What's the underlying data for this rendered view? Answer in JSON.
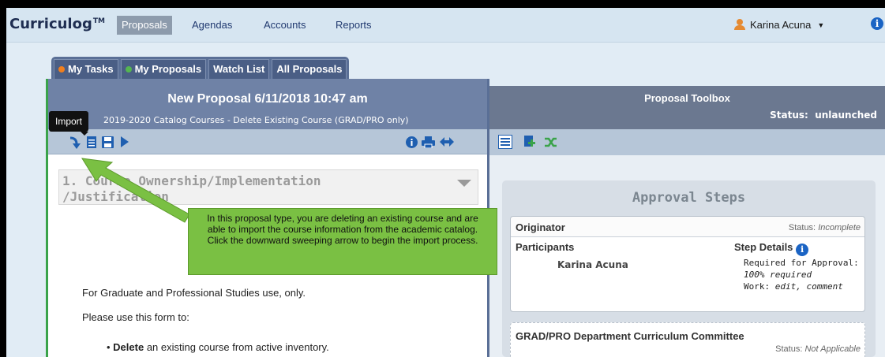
{
  "app": {
    "logo": "Curriculog",
    "logo_tm": "TM"
  },
  "nav": {
    "tabs": [
      {
        "label": "Proposals",
        "active": true
      },
      {
        "label": "Agendas"
      },
      {
        "label": "Accounts"
      },
      {
        "label": "Reports"
      }
    ],
    "user_name": "Karina Acuna"
  },
  "subtabs": [
    {
      "label": "My Tasks",
      "dot_color": "#f07f1e"
    },
    {
      "label": "My Proposals",
      "dot_color": "#55b551"
    },
    {
      "label": "Watch List"
    },
    {
      "label": "All Proposals"
    }
  ],
  "proposal": {
    "title": "New Proposal 6/11/2018 10:47 am",
    "subtitle": "2019-2020 Catalog Courses - Delete Existing Course (GRAD/PRO only)",
    "tooltip": "Import",
    "section_title": "1. Course Ownership/Implementation /Justification",
    "intro": "For Graduate and Professional Studies use, only.",
    "use_form": "Please use this form to:",
    "bullet_bold": "Delete",
    "bullet_rest": " an existing course from active inventory."
  },
  "callout": "In this proposal type, you are deleting an existing course and are able to import the course information from the academic catalog. Click the downward sweeping arrow to begin the import process.",
  "toolbox": {
    "title": "Proposal Toolbox",
    "status_label": "Status:",
    "status_value": "unlaunched",
    "steps_title": "Approval Steps",
    "originator": {
      "name": "Originator",
      "status_label": "Status:",
      "status_value": "Incomplete",
      "participants_label": "Participants",
      "participant": "Karina Acuna",
      "details_label": "Step Details",
      "req_label": "Required for Approval:",
      "req_value": "100% required",
      "work_label": "Work:",
      "work_value": "edit, comment"
    },
    "committee": {
      "name": "GRAD/PRO Department Curriculum Committee",
      "status_label": "Status:",
      "status_value": "Not Applicable"
    }
  },
  "colors": {
    "accent_green": "#7ac043",
    "header_blue": "#6f82a6",
    "icon_blue": "#1f5fb0"
  }
}
